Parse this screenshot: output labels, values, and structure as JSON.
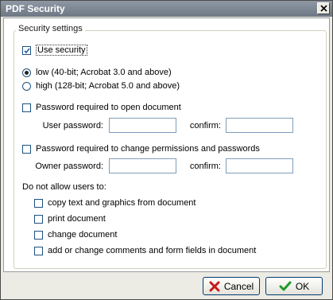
{
  "window": {
    "title": "PDF Security"
  },
  "group": {
    "label": "Security settings"
  },
  "use_security": {
    "label": "Use security",
    "checked": true
  },
  "encryption": {
    "options": [
      {
        "label": "low (40-bit; Acrobat 3.0 and above)",
        "selected": true
      },
      {
        "label": "high (128-bit; Acrobat 5.0 and above)",
        "selected": false
      }
    ]
  },
  "open_password": {
    "label": "Password required to open document",
    "checked": false,
    "user_password_label": "User password:",
    "user_password_value": "",
    "confirm_label": "confirm:",
    "confirm_value": ""
  },
  "permissions_password": {
    "label": "Password required to change permissions and passwords",
    "checked": false,
    "owner_password_label": "Owner password:",
    "owner_password_value": "",
    "confirm_label": "confirm:",
    "confirm_value": ""
  },
  "restrictions": {
    "heading": "Do not allow users to:",
    "items": [
      {
        "label": "copy text and graphics from document",
        "checked": false
      },
      {
        "label": "print document",
        "checked": false
      },
      {
        "label": "change document",
        "checked": false
      },
      {
        "label": "add or change comments and form fields in document",
        "checked": false
      }
    ]
  },
  "buttons": {
    "cancel": "Cancel",
    "ok": "OK"
  },
  "icons": {
    "close": "close-icon",
    "cancel": "red-x-icon",
    "ok": "green-check-icon"
  }
}
